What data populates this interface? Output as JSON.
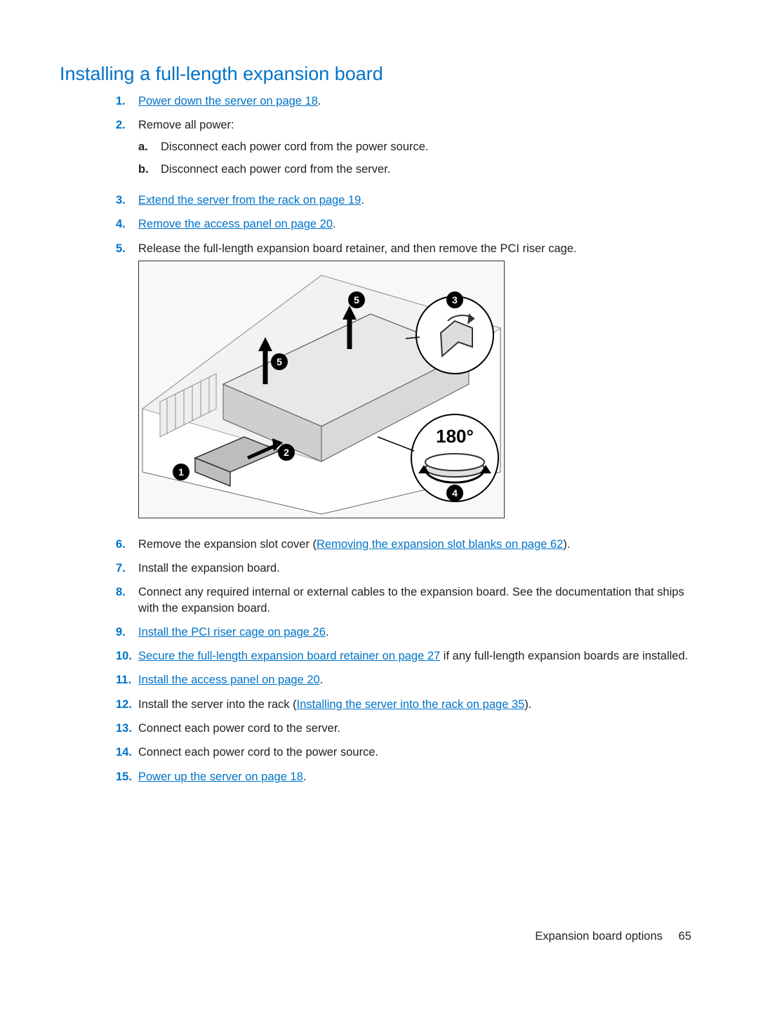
{
  "title": "Installing a full-length expansion board",
  "steps": {
    "s1": {
      "link": "Power down the server on page 18",
      "after": "."
    },
    "s2": {
      "text": "Remove all power:",
      "a": "Disconnect each power cord from the power source.",
      "b": "Disconnect each power cord from the server."
    },
    "s3": {
      "link": "Extend the server from the rack on page 19",
      "after": "."
    },
    "s4": {
      "link": "Remove the access panel on page 20",
      "after": "."
    },
    "s5": {
      "text": "Release the full-length expansion board retainer, and then remove the PCI riser cage."
    },
    "s6": {
      "before": "Remove the expansion slot cover (",
      "link": "Removing the expansion slot blanks on page 62",
      "after": ")."
    },
    "s7": {
      "text": "Install the expansion board."
    },
    "s8": {
      "text": "Connect any required internal or external cables to the expansion board. See the documentation that ships with the expansion board."
    },
    "s9": {
      "link": "Install the PCI riser cage on page 26",
      "after": "."
    },
    "s10": {
      "link": "Secure the full-length expansion board retainer on page 27",
      "after": " if any full-length expansion boards are installed."
    },
    "s11": {
      "link": "Install the access panel on page 20",
      "after": "."
    },
    "s12": {
      "before": "Install the server into the rack (",
      "link": "Installing the server into the rack on page 35",
      "after": ")."
    },
    "s13": {
      "text": "Connect each power cord to the server."
    },
    "s14": {
      "text": "Connect each power cord to the power source."
    },
    "s15": {
      "link": "Power up the server on page 18",
      "after": "."
    }
  },
  "num": {
    "s1": "1.",
    "s2": "2.",
    "s3": "3.",
    "s4": "4.",
    "s5": "5.",
    "s6": "6.",
    "s7": "7.",
    "s8": "8.",
    "s9": "9.",
    "s10": "10.",
    "s11": "11.",
    "s12": "12.",
    "s13": "13.",
    "s14": "14.",
    "s15": "15.",
    "a": "a.",
    "b": "b."
  },
  "figure": {
    "callouts": [
      "1",
      "2",
      "3",
      "4",
      "5",
      "5"
    ],
    "angle_label": "180°"
  },
  "footer": {
    "section": "Expansion board options",
    "page": "65"
  }
}
